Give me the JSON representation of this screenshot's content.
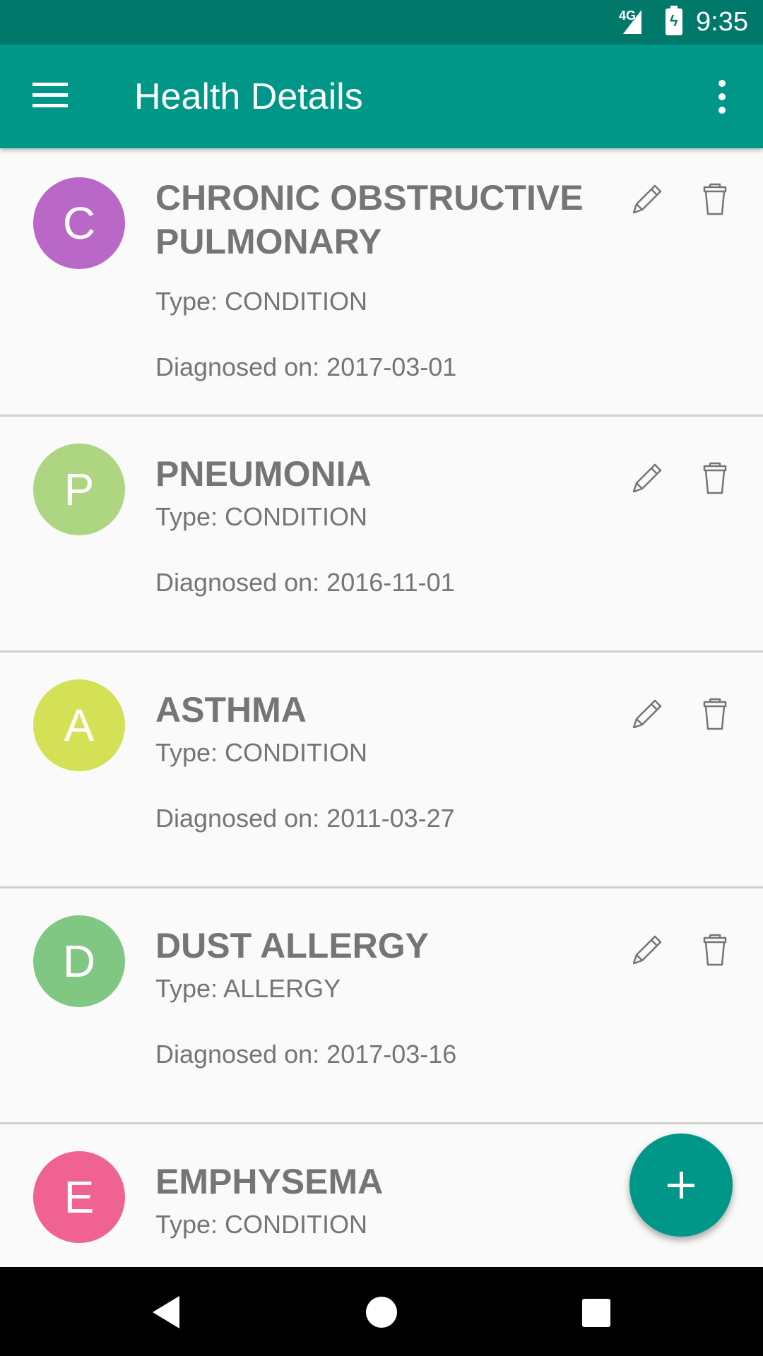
{
  "status_bar": {
    "network": "4G",
    "time": "9:35",
    "icons": [
      "signal-icon",
      "battery-charging-icon"
    ]
  },
  "app_bar": {
    "title": "Health Details",
    "background_color": "#009688",
    "status_color": "#00796b",
    "icons": [
      "menu-icon",
      "more-vert-icon"
    ]
  },
  "records": [
    {
      "initial": "C",
      "color": "#ba68c8",
      "name": "CHRONIC OBSTRUCTIVE PULMONARY",
      "type": "Type: CONDITION",
      "diagnosed": "Diagnosed on: 2017-03-01"
    },
    {
      "initial": "P",
      "color": "#aed581",
      "name": "PNEUMONIA",
      "type": "Type: CONDITION",
      "diagnosed": "Diagnosed on: 2016-11-01"
    },
    {
      "initial": "A",
      "color": "#d4e157",
      "name": "ASTHMA",
      "type": "Type: CONDITION",
      "diagnosed": "Diagnosed on: 2011-03-27"
    },
    {
      "initial": "D",
      "color": "#81c784",
      "name": "DUST ALLERGY",
      "type": "Type: ALLERGY",
      "diagnosed": "Diagnosed on: 2017-03-16"
    },
    {
      "initial": "E",
      "color": "#f06292",
      "name": "EMPHYSEMA",
      "type": "Type: CONDITION",
      "diagnosed": ""
    }
  ],
  "record_icons": [
    "edit-pencil-icon",
    "delete-trash-icon"
  ],
  "fab": {
    "icon": "add-icon",
    "color": "#009688"
  },
  "nav_bar": {
    "icons": [
      "back-icon",
      "home-icon",
      "recents-icon"
    ]
  }
}
